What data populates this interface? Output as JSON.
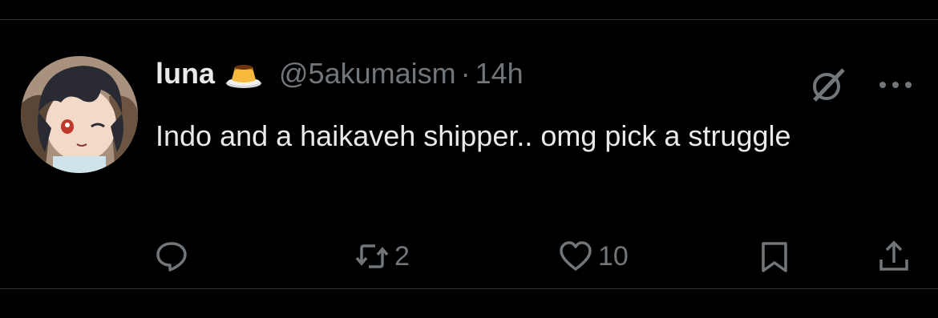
{
  "tweet": {
    "display_name": "luna",
    "name_emoji": "flan-icon",
    "handle": "@5akumaism",
    "separator": "·",
    "time": "14h",
    "text": "Indo and a haikaveh shipper.. omg pick a struggle",
    "actions": {
      "reply_count": "",
      "retweet_count": "2",
      "like_count": "10"
    }
  },
  "icons": [
    "grok-icon",
    "more-icon",
    "reply-icon",
    "retweet-icon",
    "heart-icon",
    "bookmark-icon",
    "share-icon"
  ],
  "colors": {
    "background": "#000000",
    "text": "#e7e9ea",
    "muted": "#71767b",
    "divider": "#2f3336"
  }
}
